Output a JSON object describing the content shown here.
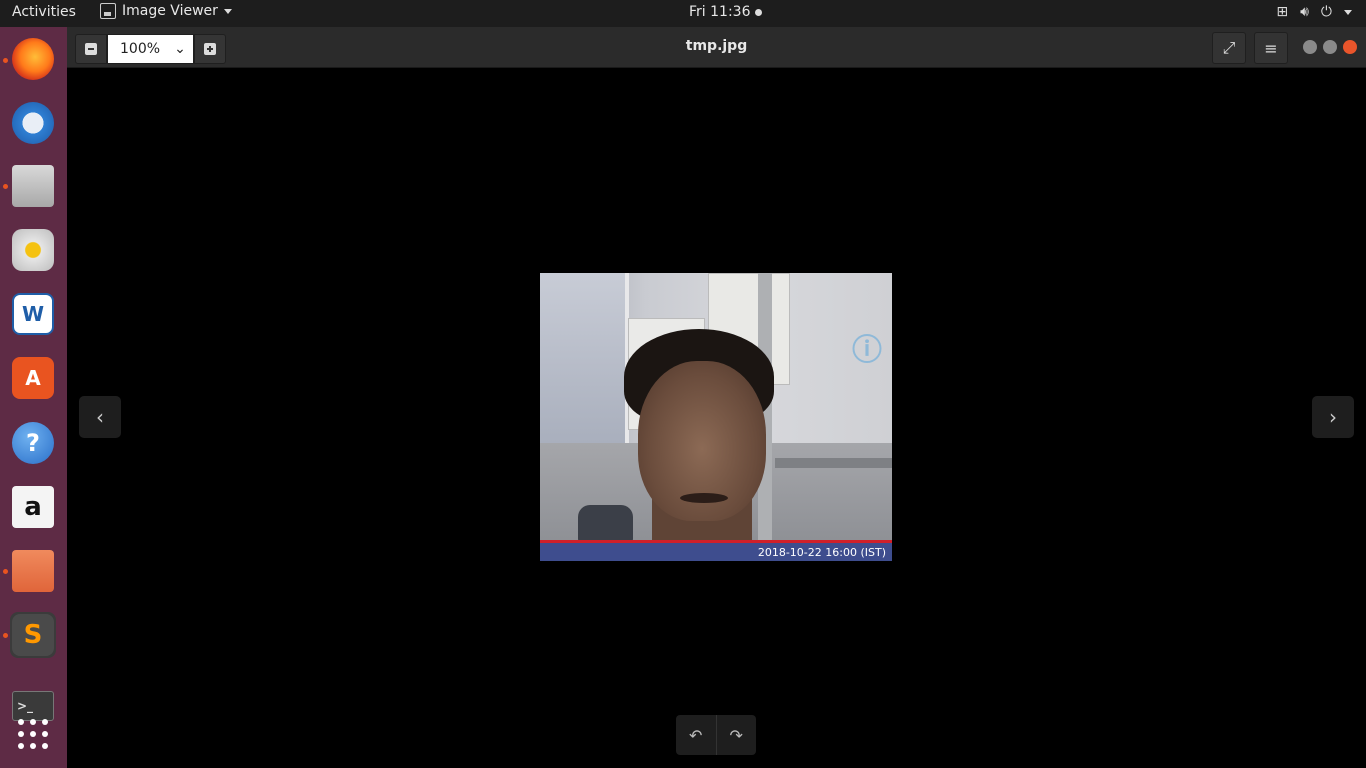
{
  "topbar": {
    "activities": "Activities",
    "app_menu": "Image Viewer",
    "clock": "Fri 11:36",
    "icons": [
      "network-icon",
      "volume-icon",
      "power-icon"
    ]
  },
  "dock": {
    "items": [
      {
        "name": "firefox",
        "icon": "firefox-icon",
        "running": true
      },
      {
        "name": "thunderbird",
        "icon": "mail-icon",
        "running": false
      },
      {
        "name": "files",
        "icon": "files-icon",
        "running": true
      },
      {
        "name": "rhythmbox",
        "icon": "music-icon",
        "running": false
      },
      {
        "name": "libreoffice-writer",
        "icon": "writer-icon",
        "running": false
      },
      {
        "name": "ubuntu-software",
        "icon": "software-icon",
        "running": false
      },
      {
        "name": "help",
        "icon": "help-icon",
        "running": false
      },
      {
        "name": "amazon",
        "icon": "amazon-icon",
        "running": false
      },
      {
        "name": "archive-manager",
        "icon": "archive-icon",
        "running": true
      },
      {
        "name": "sublime-text",
        "icon": "sublime-icon",
        "running": true
      },
      {
        "name": "terminal",
        "icon": "terminal-icon",
        "running": false
      },
      {
        "name": "show-applications",
        "icon": "grid-icon",
        "running": false
      }
    ],
    "help_glyph": "?",
    "amazon_glyph": "a",
    "writer_glyph": "W",
    "software_glyph": "A",
    "sublime_glyph": "S"
  },
  "viewer": {
    "zoom": "100%",
    "title": "tmp.jpg",
    "image_timestamp": "2018-10-22 16:00 (IST)"
  },
  "colors": {
    "dock_bg": "#5e2b45",
    "accent": "#e95420",
    "close": "#e9552b"
  }
}
